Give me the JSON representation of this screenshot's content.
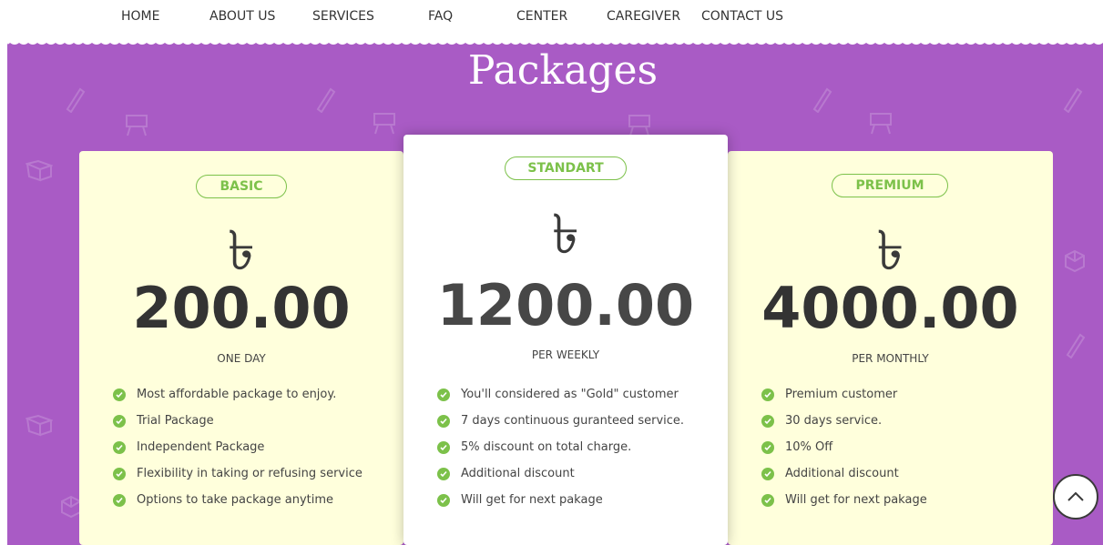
{
  "nav": {
    "items": [
      {
        "label": "HOME"
      },
      {
        "label": "ABOUT US"
      },
      {
        "label": "SERVICES"
      },
      {
        "label": "FAQ"
      },
      {
        "label": "CENTER"
      },
      {
        "label": "CAREGIVER"
      },
      {
        "label": "CONTACT US"
      }
    ]
  },
  "section": {
    "title": "Packages",
    "background_color": "#a95bc5"
  },
  "packages": [
    {
      "badge": "BASIC",
      "currency_symbol": "৳",
      "price": "200.00",
      "period": "ONE DAY",
      "features": [
        "Most affordable package to enjoy.",
        "Trial Package",
        "Independent Package",
        "Flexibility in taking or refusing service",
        "Options to take package anytime"
      ]
    },
    {
      "badge": "STANDART",
      "currency_symbol": "৳",
      "price": "1200.00",
      "period": "PER WEEKLY",
      "features": [
        "You'll considered as \"Gold\" customer",
        "7 days continuous guranteed service.",
        "5% discount on total charge.",
        "Additional discount",
        "Will get for next pakage"
      ]
    },
    {
      "badge": "PREMIUM",
      "currency_symbol": "৳",
      "price": "4000.00",
      "period": "PER MONTHLY",
      "features": [
        "Premium customer",
        "30 days service.",
        "10% Off",
        "Additional discount",
        "Will get for next pakage"
      ]
    }
  ],
  "colors": {
    "accent_green": "#7cc14a",
    "card_cream": "#ffffdc",
    "card_featured": "#ffffff"
  },
  "scroll_top": {
    "icon": "chevron-up-icon"
  }
}
